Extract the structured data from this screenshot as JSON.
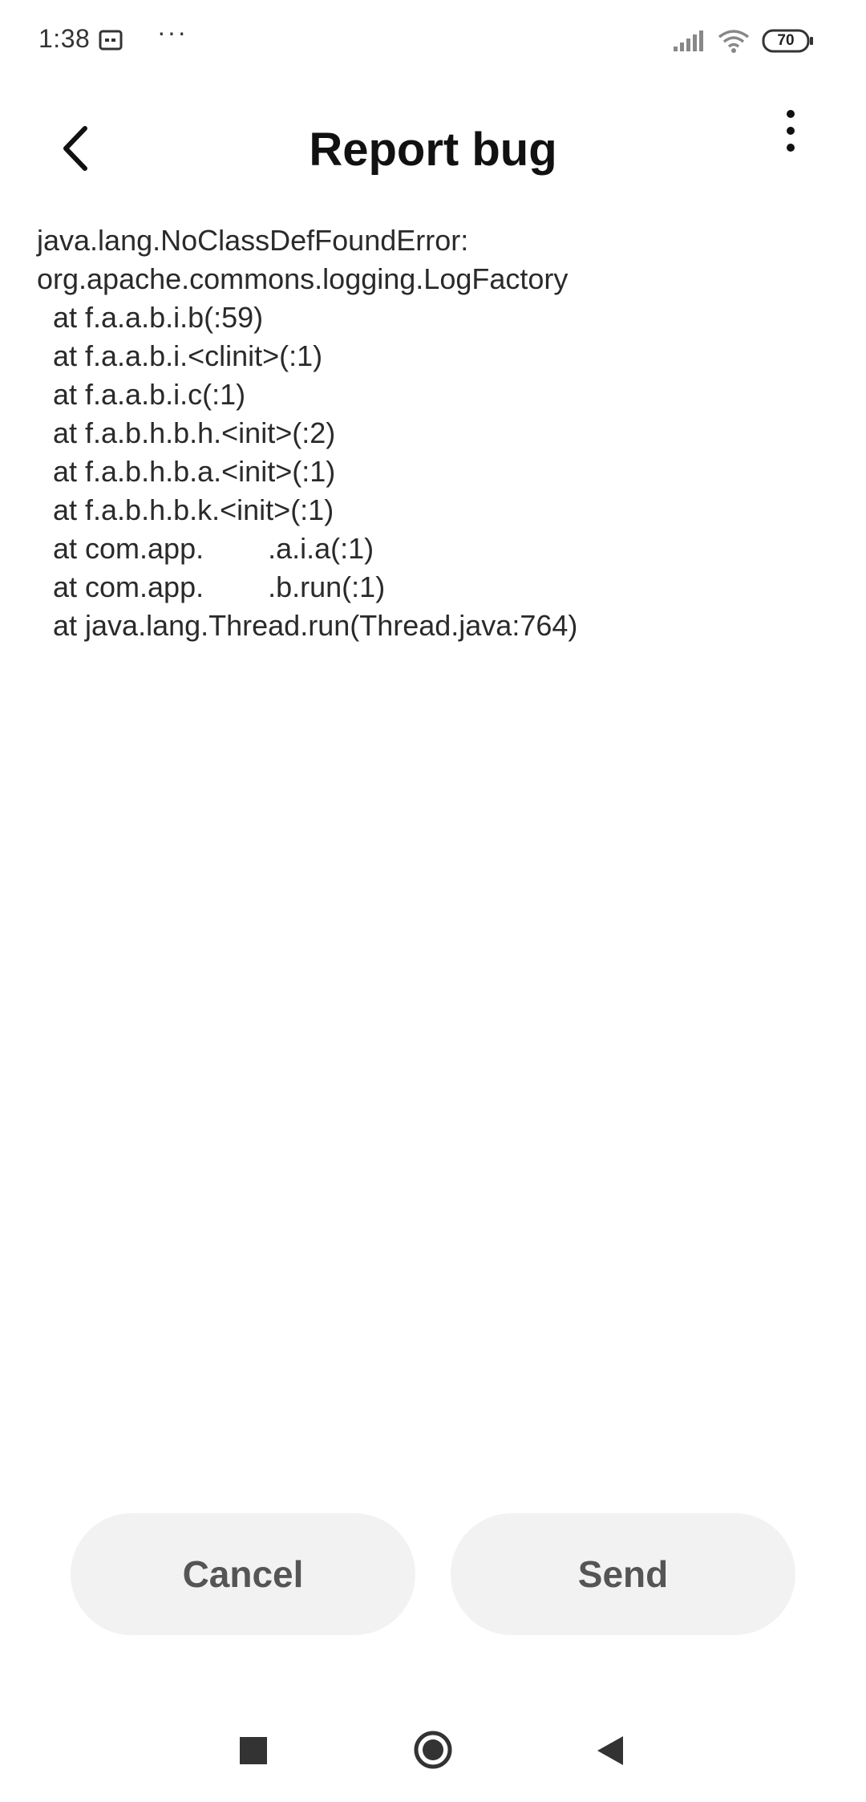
{
  "status_bar": {
    "time": "1:38",
    "more": "···",
    "battery": "70",
    "icons": [
      "app-notification-icon",
      "signal-icon",
      "wifi-icon",
      "battery-icon"
    ]
  },
  "header": {
    "title": "Report bug",
    "back_icon": "chevron-left-icon",
    "more_icon": "more-vertical-icon"
  },
  "trace": {
    "lines": [
      "java.lang.NoClassDefFoundError:",
      "org.apache.commons.logging.LogFactory",
      "at f.a.a.b.i.b(:59)",
      "at f.a.a.b.i.<clinit>(:1)",
      "at f.a.a.b.i.c(:1)",
      "at f.a.b.h.b.h.<init>(:2)",
      "at f.a.b.h.b.a.<init>(:1)",
      "at f.a.b.h.b.k.<init>(:1)",
      "at com.app.        .a.i.a(:1)",
      "at com.app.        .b.run(:1)",
      "at java.lang.Thread.run(Thread.java:764)"
    ]
  },
  "actions": {
    "cancel_label": "Cancel",
    "send_label": "Send"
  },
  "nav_bar": {
    "icons": [
      "recent-apps-icon",
      "home-icon",
      "back-icon"
    ]
  }
}
